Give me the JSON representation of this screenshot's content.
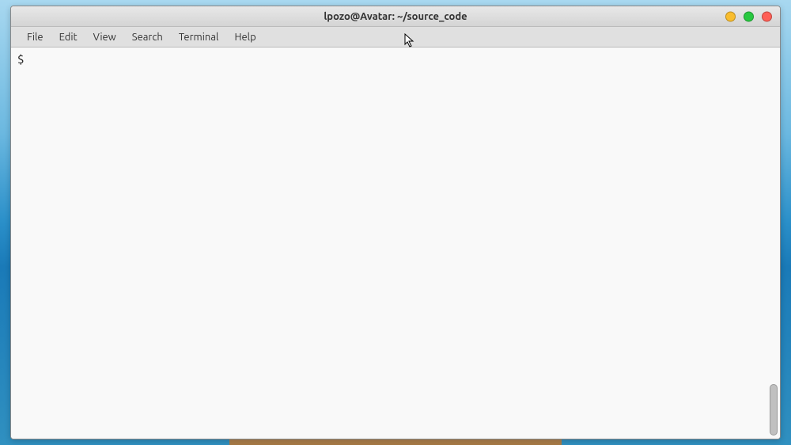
{
  "window": {
    "title": "lpozo@Avatar: ~/source_code"
  },
  "menubar": {
    "items": [
      "File",
      "Edit",
      "View",
      "Search",
      "Terminal",
      "Help"
    ]
  },
  "terminal": {
    "prompt": "$ "
  }
}
